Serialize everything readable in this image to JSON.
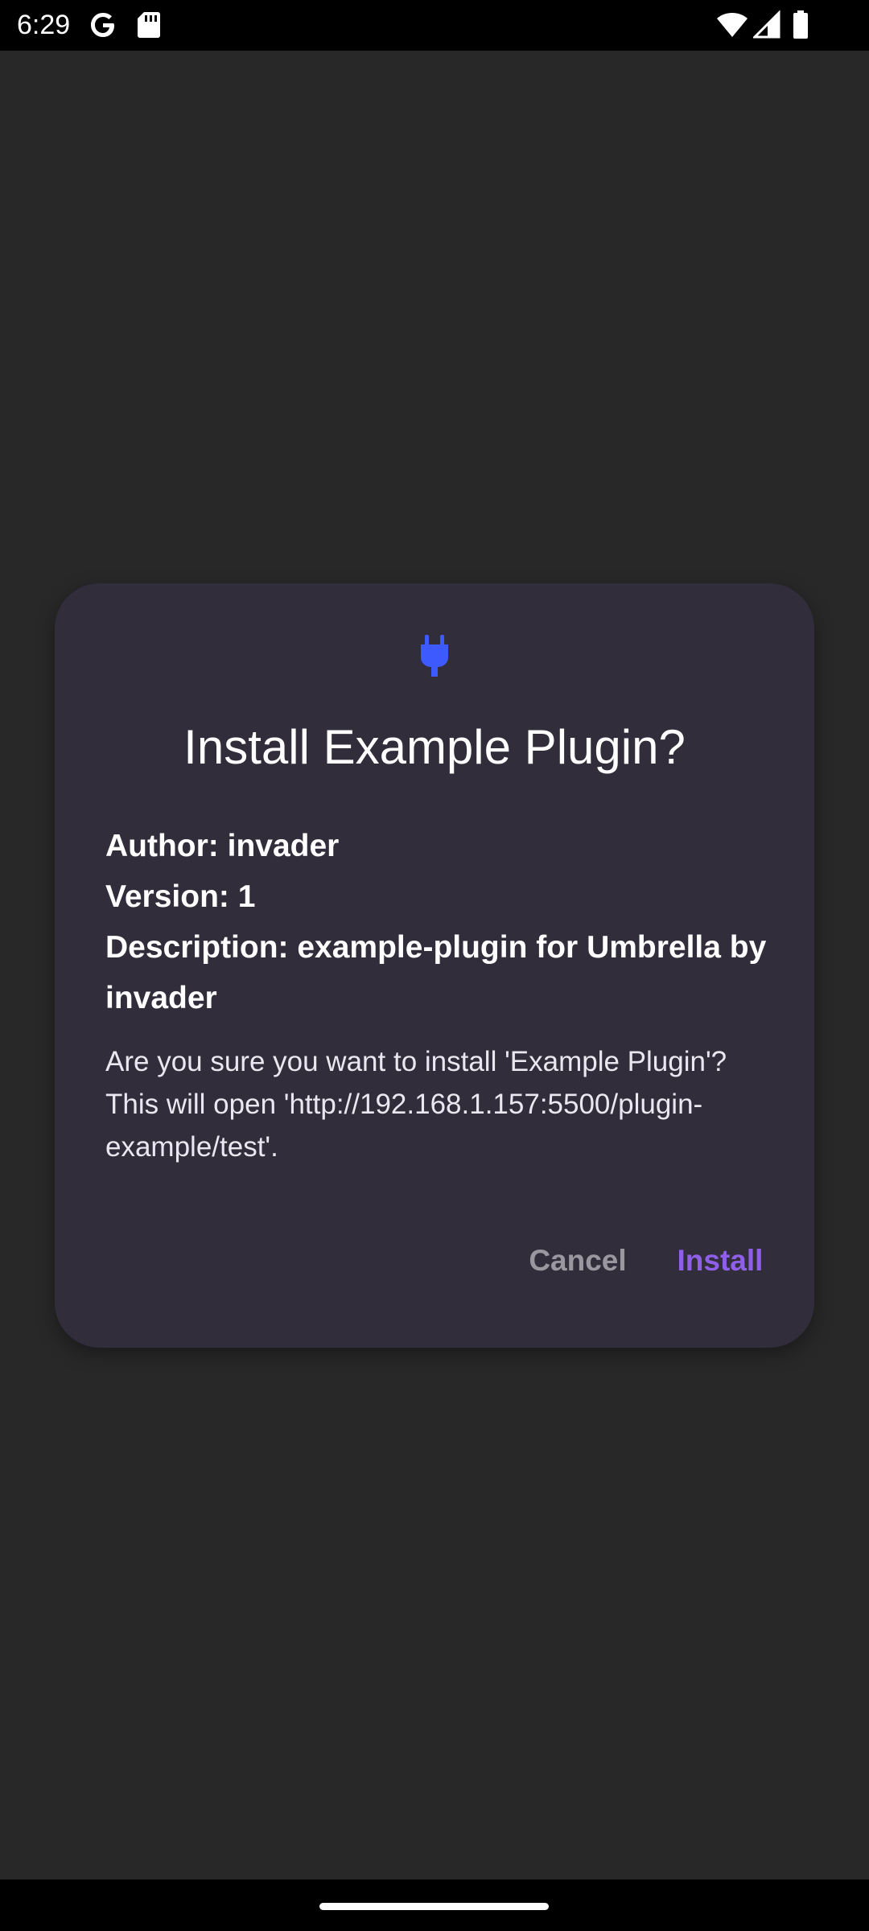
{
  "status_bar": {
    "time": "6:29",
    "left_icons": [
      "google-icon",
      "sd-card-icon"
    ],
    "right_icons": [
      "wifi-icon",
      "cellular-signal-icon",
      "battery-icon"
    ]
  },
  "dialog": {
    "icon": "plug-icon",
    "icon_color": "#3d5afe",
    "title": "Install Example Plugin?",
    "author": "Author: invader",
    "version": "Version: 1",
    "description": "Description: example-plugin for Umbrella by invader",
    "message": "Are you sure you want to install 'Example Plugin'? This will open 'http://192.168.1.157:5500/plugin-example/test'.",
    "cancel_label": "Cancel",
    "install_label": "Install",
    "accent_color": "#8f5fe8"
  },
  "colors": {
    "background": "#282828",
    "dialog_surface": "#322d3b",
    "status_bar": "#000000"
  }
}
